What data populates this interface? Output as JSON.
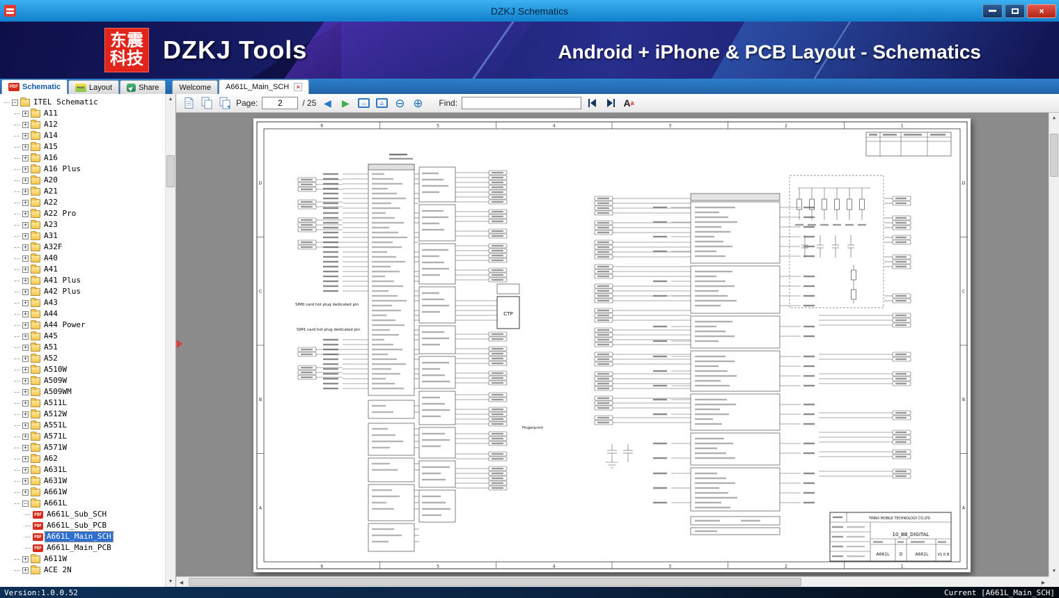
{
  "window": {
    "title": "DZKJ Schematics"
  },
  "banner": {
    "logo_line1": "东震",
    "logo_line2": "科技",
    "app_name": "DZKJ Tools",
    "tagline": "Android + iPhone & PCB Layout - Schematics"
  },
  "icons": {
    "pdf_badge": "PDF",
    "pads_badge": "PADS",
    "close": "×",
    "prev": "◀",
    "next": "▶",
    "up": "▲",
    "down": "▼",
    "left": "◀",
    "right": "▶",
    "zoom_out": "⊖",
    "zoom_in": "⊕",
    "fit_h": "↔",
    "fit_v": "↕",
    "font_main": "A",
    "font_sup": "a"
  },
  "tabs": {
    "app": [
      {
        "label": "Schematic"
      },
      {
        "label": "Layout"
      },
      {
        "label": "Share"
      }
    ],
    "docs": [
      {
        "label": "Welcome"
      },
      {
        "label": "A661L_Main_SCH"
      }
    ]
  },
  "toolbar": {
    "page_label": "Page:",
    "page_value": "2",
    "page_total": "/ 25",
    "find_label": "Find:",
    "find_value": ""
  },
  "tree": {
    "root": "ITEL Schematic",
    "nodes": [
      {
        "label": "A11"
      },
      {
        "label": "A12"
      },
      {
        "label": "A14"
      },
      {
        "label": "A15"
      },
      {
        "label": "A16"
      },
      {
        "label": "A16 Plus"
      },
      {
        "label": "A20"
      },
      {
        "label": "A21"
      },
      {
        "label": "A22"
      },
      {
        "label": "A22 Pro"
      },
      {
        "label": "A23"
      },
      {
        "label": "A31"
      },
      {
        "label": "A32F"
      },
      {
        "label": "A40"
      },
      {
        "label": "A41"
      },
      {
        "label": "A41 Plus"
      },
      {
        "label": "A42 Plus"
      },
      {
        "label": "A43"
      },
      {
        "label": "A44"
      },
      {
        "label": "A44 Power"
      },
      {
        "label": "A45"
      },
      {
        "label": "A51"
      },
      {
        "label": "A52"
      },
      {
        "label": "A510W"
      },
      {
        "label": "A509W"
      },
      {
        "label": "A509WM"
      },
      {
        "label": "A511L"
      },
      {
        "label": "A512W"
      },
      {
        "label": "A551L"
      },
      {
        "label": "A571L"
      },
      {
        "label": "A571W"
      },
      {
        "label": "A62"
      },
      {
        "label": "A631L"
      },
      {
        "label": "A631W"
      },
      {
        "label": "A661W"
      },
      {
        "label": "A661L",
        "expanded": true,
        "children": [
          {
            "label": "A661L_Sub_SCH"
          },
          {
            "label": "A661L_Sub_PCB"
          },
          {
            "label": "A661L_Main_SCH",
            "selected": true
          },
          {
            "label": "A661L_Main_PCB"
          }
        ]
      },
      {
        "label": "A611W"
      },
      {
        "label": "ACE 2N"
      }
    ]
  },
  "schematic": {
    "grid_cols": [
      "6",
      "5",
      "4",
      "3",
      "2",
      "1"
    ],
    "grid_rows": [
      "D",
      "C",
      "B",
      "A"
    ],
    "annotations": {
      "sim0": "SIM0 card hot plug dedicated pin",
      "sim1": "SIM1 card hot plug dedicated pin",
      "ctp": "CTP",
      "fingerprint": "Fingerprint"
    },
    "title_block": {
      "company": "TINNO MOBILE TECHNOLOGY CO.LTD",
      "title": "10_BB_DIGITAL",
      "code": "A661L",
      "size": "D",
      "drawing_no": "A661L",
      "rev": "V1.0 B"
    }
  },
  "status": {
    "left": "Version:1.0.0.52",
    "right": "Current [A661L_Main_SCH]"
  }
}
